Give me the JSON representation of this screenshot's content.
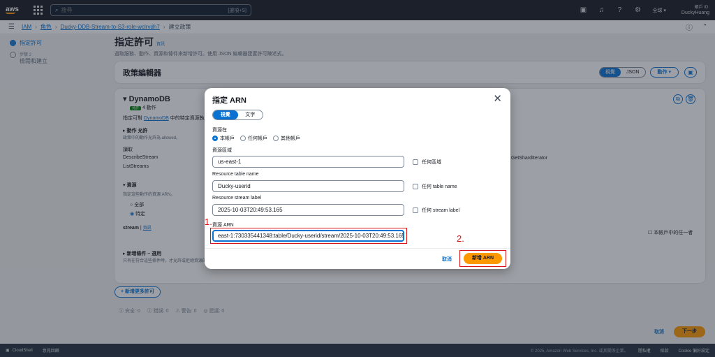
{
  "topnav": {
    "logo": "aws",
    "search_placeholder": "搜尋",
    "search_shortcut": "[選項+S]",
    "region": "全球 ▾",
    "account_label": "帳戶 ID:",
    "account_name": "DuckyHuang",
    "icons": [
      "cloudshell-icon",
      "bell-icon",
      "help-icon",
      "gear-icon"
    ]
  },
  "breadcrumb": {
    "items": [
      "IAM",
      "角色",
      "Ducky-DDB-Stream-to-S3-role-wclrvdh7"
    ],
    "current": "建立政策"
  },
  "steps": [
    {
      "sub": "",
      "label": "指定許可",
      "active": true
    },
    {
      "sub": "步驟 2",
      "label": "檢閱和建立",
      "active": false
    }
  ],
  "page": {
    "title": "指定許可",
    "info": "資訊",
    "desc": "選取服務、動作、資源和條件來新增許可。使用 JSON 編輯器建置許可陳述式。"
  },
  "editor": {
    "title": "政策編輯器",
    "toggle": [
      "視覺",
      "JSON"
    ],
    "actions_btn": "動作 ▾"
  },
  "service": {
    "name": "DynamoDB",
    "badge": "允許",
    "actions_count": "4 動作",
    "desc_prefix": "指定可對",
    "desc_link": "DynamoDB",
    "desc_suffix": "中的特定資源執行",
    "actions_head": "▸ 動作 允許",
    "actions_sub": "政策中的動作允許為 allowed。",
    "read_label": "讀取",
    "action_items": [
      "DescribeStream",
      "ListStreams"
    ],
    "right_item": "GetShardIterator",
    "resources_head": "▾ 資源",
    "resources_sub": "指定這些動作的資源 ARN。",
    "res_options": [
      "全部",
      "特定"
    ],
    "stream_label": "stream",
    "stream_info": "資訊",
    "any_in_account": "本帳戶中的任一者",
    "cond_head": "▸ 新增條件 – 選用",
    "cond_sub": "只有在符合這些條件時，才允許或拒絕資源的動作。"
  },
  "add_more": "+ 新增更多許可",
  "status": [
    "ⓧ 安全: 0",
    "ⓧ 錯誤: 0",
    "⚠ 警告: 0",
    "◎ 建議: 0"
  ],
  "footer": {
    "cancel": "取消",
    "next": "下一步"
  },
  "bottombar": {
    "cloudshell": "CloudShell",
    "feedback": "意見回饋",
    "copyright": "© 2025, Amazon Web Services, Inc. 或其關係企業。",
    "links": [
      "隱私權",
      "條款",
      "Cookie 偏好設定"
    ]
  },
  "modal": {
    "title": "指定 ARN",
    "toggle": [
      "視覺",
      "文字"
    ],
    "resource_in_label": "資源在",
    "resource_in_options": [
      "本帳戶",
      "任何帳戶",
      "其他帳戶"
    ],
    "region_label": "資源區域",
    "region_value": "us-east-1",
    "region_any": "任何區域",
    "table_label": "Resource table name",
    "table_value": "Ducky-userid",
    "table_any": "任何 table name",
    "stream_label": "Resource stream label",
    "stream_value": "2025-10-03T20:49:53.165",
    "stream_any": "任何 stream label",
    "arn_label": "資源 ARN",
    "arn_value": "east-1:730335441348:table/Ducky-userid/stream/2025-10-03T20:49:53.165",
    "cancel": "取消",
    "add": "新增 ARN",
    "annotation1": "1.",
    "annotation2": "2."
  },
  "colors": {
    "accent": "#0972d3",
    "primary_button": "#ff9900",
    "annotation": "#d91515",
    "nav": "#16191f"
  }
}
